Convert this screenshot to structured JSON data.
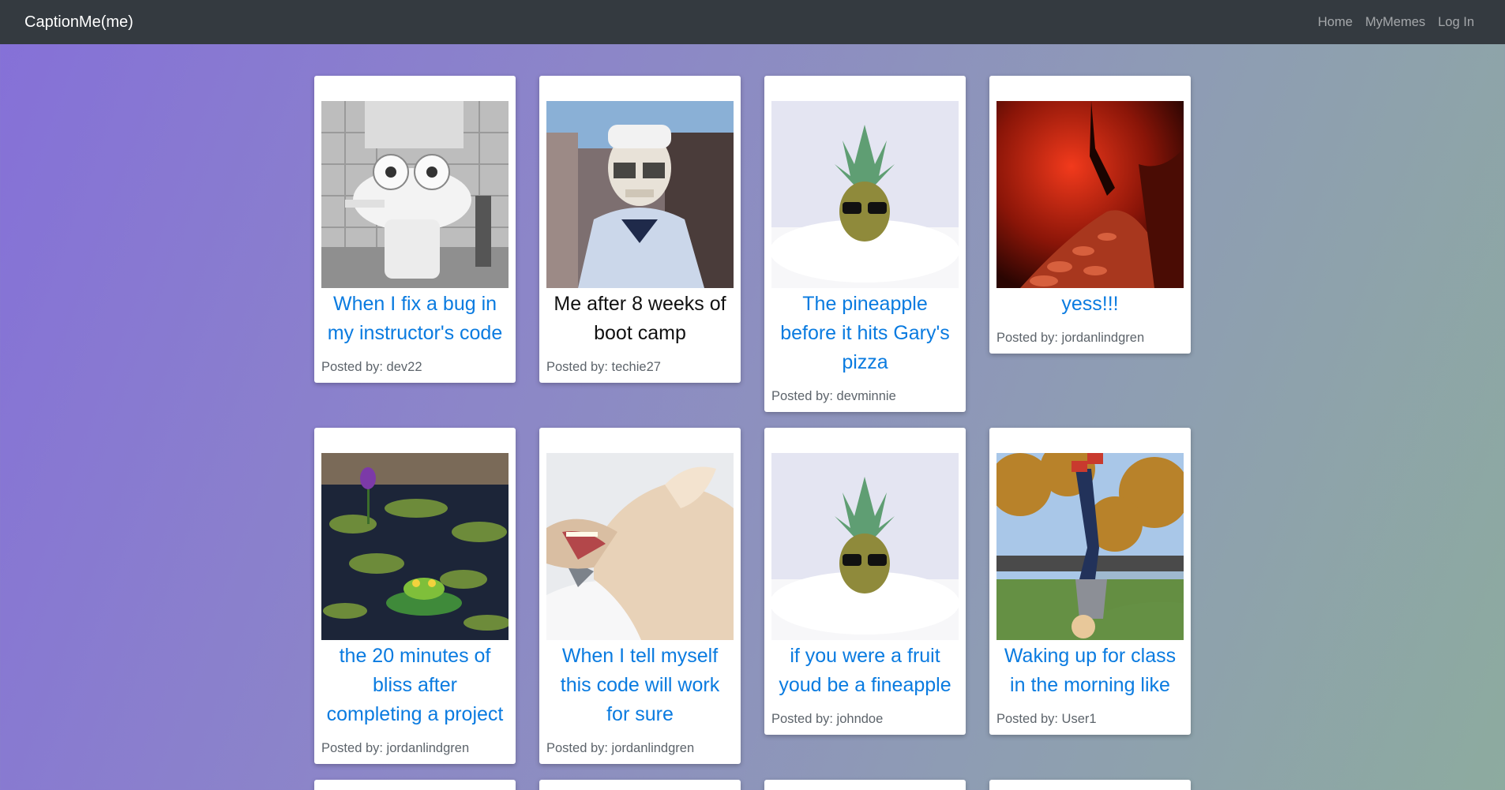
{
  "navbar": {
    "brand": "CaptionMe(me)",
    "links": [
      "Home",
      "MyMemes",
      "Log In"
    ]
  },
  "memes": [
    {
      "caption": "When I fix a bug in my instructor's code",
      "poster": "Posted by: dev22",
      "image": "toilet-frog-photo"
    },
    {
      "caption": "Me after 8 weeks of boot camp",
      "poster": "Posted by: techie27",
      "image": "skeleton-in-labcoat-photo"
    },
    {
      "caption": "The pineapple before it hits Gary's pizza",
      "poster": "Posted by: devminnie",
      "image": "pineapple-sunglasses-photo"
    },
    {
      "caption": "yess!!!",
      "poster": "Posted by: jordanlindgren",
      "image": "red-forest-path-photo"
    },
    {
      "caption": "the 20 minutes of bliss after completing a project",
      "poster": "Posted by: jordanlindgren",
      "image": "frog-on-lilypad-photo"
    },
    {
      "caption": "When I tell myself this code will work for sure",
      "poster": "Posted by: jordanlindgren",
      "image": "laughing-horse-photo"
    },
    {
      "caption": "if you were a fruit youd be a fineapple",
      "poster": "Posted by: johndoe",
      "image": "pineapple-sunglasses-photo"
    },
    {
      "caption": "Waking up for class in the morning like",
      "poster": "Posted by: User1",
      "image": "child-handstand-photo"
    }
  ],
  "colors": {
    "navbar": "#343a40",
    "link": "#0a7be0",
    "bg_start": "#8570d8",
    "bg_end": "#8dab9f"
  }
}
